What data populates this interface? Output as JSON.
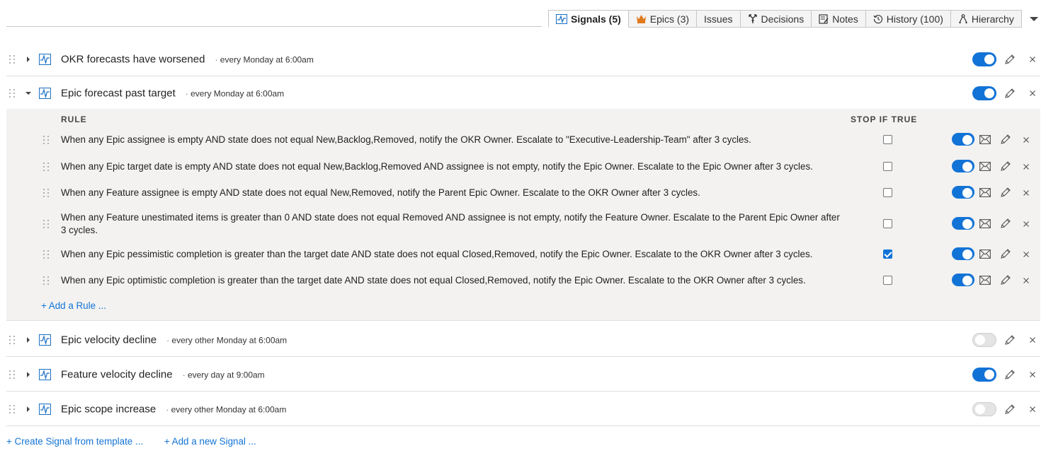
{
  "tabs": [
    {
      "label": "Signals (5)",
      "icon": "signal-icon",
      "active": true
    },
    {
      "label": "Epics (3)",
      "icon": "crown-icon",
      "active": false
    },
    {
      "label": "Issues",
      "icon": "",
      "active": false
    },
    {
      "label": "Decisions",
      "icon": "decision-icon",
      "active": false
    },
    {
      "label": "Notes",
      "icon": "notes-icon",
      "active": false
    },
    {
      "label": "History (100)",
      "icon": "history-icon",
      "active": false
    },
    {
      "label": "Hierarchy",
      "icon": "hierarchy-icon",
      "active": false
    }
  ],
  "signals": [
    {
      "title": "OKR forecasts have worsened",
      "schedule": "every Monday at 6:00am",
      "enabled": true,
      "expanded": false
    },
    {
      "title": "Epic forecast past target",
      "schedule": "every Monday at 6:00am",
      "enabled": true,
      "expanded": true
    },
    {
      "title": "Epic velocity decline",
      "schedule": "every other Monday at 6:00am",
      "enabled": false,
      "expanded": false
    },
    {
      "title": "Feature velocity decline",
      "schedule": "every day at 9:00am",
      "enabled": true,
      "expanded": false
    },
    {
      "title": "Epic scope increase",
      "schedule": "every other Monday at 6:00am",
      "enabled": false,
      "expanded": false
    }
  ],
  "rules_panel": {
    "header_rule": "RULE",
    "header_stop": "STOP IF TRUE",
    "add_rule": "+ Add a Rule ...",
    "rules": [
      {
        "text": "When any Epic assignee is empty AND state does not equal New,Backlog,Removed, notify the OKR Owner. Escalate to \"Executive-Leadership-Team\" after 3 cycles.",
        "stop_if_true": false,
        "enabled": true
      },
      {
        "text": "When any Epic target date is empty AND state does not equal New,Backlog,Removed AND assignee is not empty, notify the Epic Owner. Escalate to the Epic Owner after 3 cycles.",
        "stop_if_true": false,
        "enabled": true
      },
      {
        "text": "When any Feature assignee is empty AND state does not equal New,Removed, notify the Parent Epic Owner. Escalate to the OKR Owner after 3 cycles.",
        "stop_if_true": false,
        "enabled": true
      },
      {
        "text": "When any Feature unestimated items is greater than 0 AND state does not equal Removed AND assignee is not empty, notify the Feature Owner. Escalate to the Parent Epic Owner after 3 cycles.",
        "stop_if_true": false,
        "enabled": true
      },
      {
        "text": "When any Epic pessimistic completion is greater than the target date AND state does not equal Closed,Removed, notify the Epic Owner. Escalate to the OKR Owner after 3 cycles.",
        "stop_if_true": true,
        "enabled": true
      },
      {
        "text": "When any Epic optimistic completion is greater than the target date AND state does not equal Closed,Removed, notify the Epic Owner. Escalate to the OKR Owner after 3 cycles.",
        "stop_if_true": false,
        "enabled": true
      }
    ]
  },
  "footer": {
    "create_from_template": "+ Create Signal from template ...",
    "add_new_signal": "+ Add a new Signal ..."
  },
  "colors": {
    "accent": "#1273d6",
    "panel_bg": "#f3f2f1",
    "crown": "#e07a1f"
  }
}
